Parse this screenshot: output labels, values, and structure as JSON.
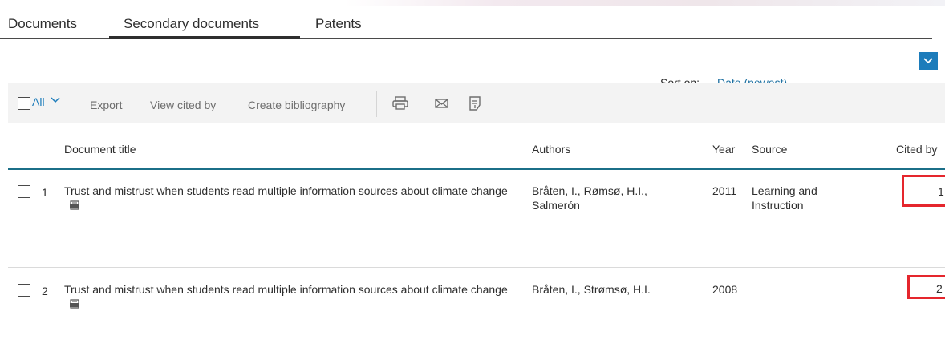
{
  "tabs": [
    {
      "label": "Documents",
      "active": false
    },
    {
      "label": "Secondary documents",
      "active": true
    },
    {
      "label": "Patents",
      "active": false
    }
  ],
  "sort": {
    "label": "Sort on:",
    "value": "Date (newest)",
    "icon": "chevron-down-icon"
  },
  "toolbar": {
    "select_all_label": "All",
    "actions": [
      "Export",
      "View cited by",
      "Create bibliography"
    ],
    "icons": [
      "print-icon",
      "email-icon",
      "save-to-list-icon"
    ]
  },
  "table": {
    "columns": [
      "Document title",
      "Authors",
      "Year",
      "Source",
      "Cited by"
    ],
    "rows": [
      {
        "num": "1",
        "title": "Trust and mistrust when students read multiple information sources about climate change",
        "authors": "Bråten, I., Rømsø, H.I., Salmerón",
        "year": "2011",
        "source": "Learning and Instruction",
        "cited_by": "1"
      },
      {
        "num": "2",
        "title": "Trust and mistrust when students read multiple information sources about climate change",
        "authors": "Bråten, I., Strømsø, H.I.",
        "year": "2008",
        "source": "",
        "cited_by": "2"
      }
    ]
  },
  "colors": {
    "accent": "#1c7cbb",
    "header_rule": "#1b6f88",
    "highlight": "#e5262d",
    "toolbar_bg": "#f3f3f3"
  }
}
